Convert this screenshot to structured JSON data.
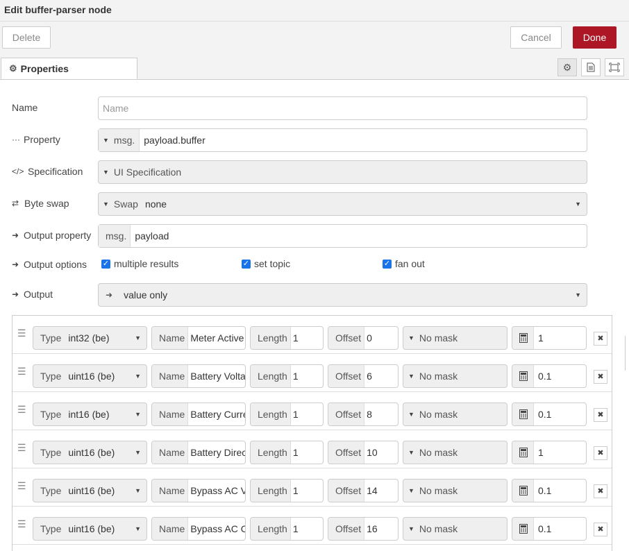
{
  "title": "Edit buffer-parser node",
  "buttons": {
    "delete": "Delete",
    "cancel": "Cancel",
    "done": "Done"
  },
  "tab": {
    "label": "Properties"
  },
  "form": {
    "name": {
      "label": "Name",
      "placeholder": "Name"
    },
    "property": {
      "label": "Property",
      "prefix": "msg.",
      "value": "payload.buffer"
    },
    "specification": {
      "label": "Specification",
      "value": "UI Specification"
    },
    "byteswap": {
      "label": "Byte swap",
      "prefix": "Swap",
      "value": "none"
    },
    "output_property": {
      "label": "Output property",
      "prefix": "msg.",
      "value": "payload"
    },
    "output_options": {
      "label": "Output options",
      "options": [
        "multiple results",
        "set topic",
        "fan out"
      ]
    },
    "output": {
      "label": "Output",
      "value": "value only"
    }
  },
  "columns": {
    "type": "Type",
    "name": "Name",
    "length": "Length",
    "offset": "Offset"
  },
  "rows": [
    {
      "type": "int32 (be)",
      "name": "Meter Active",
      "length": "1",
      "offset": "0",
      "mask": "No mask",
      "scale": "1"
    },
    {
      "type": "uint16 (be)",
      "name": "Battery Voltag",
      "length": "1",
      "offset": "6",
      "mask": "No mask",
      "scale": "0.1"
    },
    {
      "type": "int16 (be)",
      "name": "Battery Curre",
      "length": "1",
      "offset": "8",
      "mask": "No mask",
      "scale": "0.1"
    },
    {
      "type": "uint16 (be)",
      "name": "Battery Direc",
      "length": "1",
      "offset": "10",
      "mask": "No mask",
      "scale": "1"
    },
    {
      "type": "uint16 (be)",
      "name": "Bypass AC V",
      "length": "1",
      "offset": "14",
      "mask": "No mask",
      "scale": "0.1"
    },
    {
      "type": "uint16 (be)",
      "name": "Bypass AC C",
      "length": "1",
      "offset": "16",
      "mask": "No mask",
      "scale": "0.1"
    }
  ]
}
